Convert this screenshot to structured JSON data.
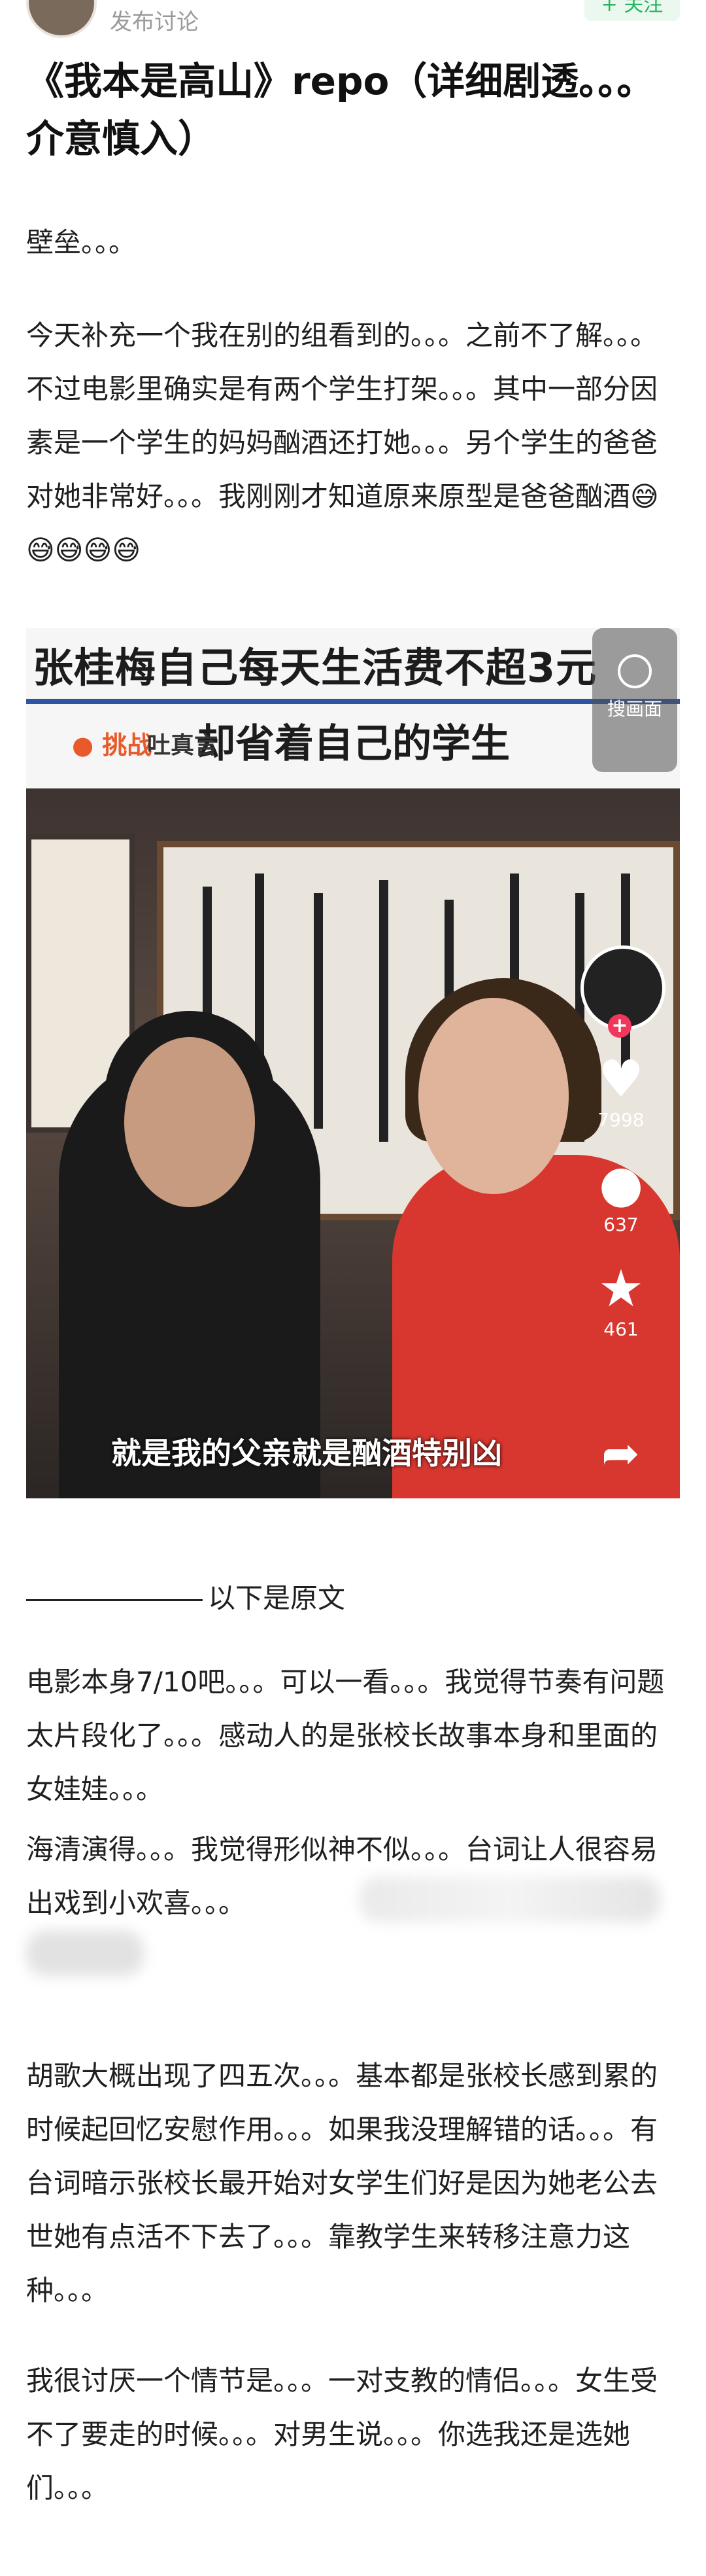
{
  "header": {
    "subtitle": "发布讨论",
    "follow_label": "+ 关注"
  },
  "post": {
    "title": "《我本是高山》repo（详细剧透。。。介意慎入）",
    "paragraphs": [
      "壁垒。。。",
      "今天补充一个我在别的组看到的。。。之前不了解。。。不过电影里确实是有两个学生打架。。。其中一部分因素是一个学生的妈妈酗酒还打她。。。另个学生的爸爸对她非常好。。。我刚刚才知道原来原型是爸爸酗酒😅😅😅😅😅",
      "电影本身7/10吧。。。可以一看。。。我觉得节奏有问题太片段化了。。。感动人的是张校长故事本身和里面的女娃娃。。。",
      "海清演得。。。我觉得形似神不似。。。台词让人很容易出戏到小欢喜。。。",
      "胡歌大概出现了四五次。。。基本都是张校长感到累的时候起回忆安慰作用。。。如果我没理解错的话。。。有台词暗示张校长最开始对女学生们好是因为她老公去世她有点活不下去了。。。靠教学生来转移注意力这种。。。",
      "我很讨厌一个情节是。。。一对支教的情侣。。。女生受不了要走的时候。。。对男生说。。。你选我还是选她们。。。"
    ],
    "divider_text": "以下是原文"
  },
  "image": {
    "caption_top": "张桂梅自己每天生活费不超3元",
    "caption_second": "却省着自己的学生",
    "challenge_label": "挑战",
    "challenge_text": "吐真言",
    "search_label": "搜画面",
    "like_count": "7998",
    "comment_count": "637",
    "star_count": "461",
    "subtitle": "就是我的父亲就是酗酒特别凶"
  }
}
